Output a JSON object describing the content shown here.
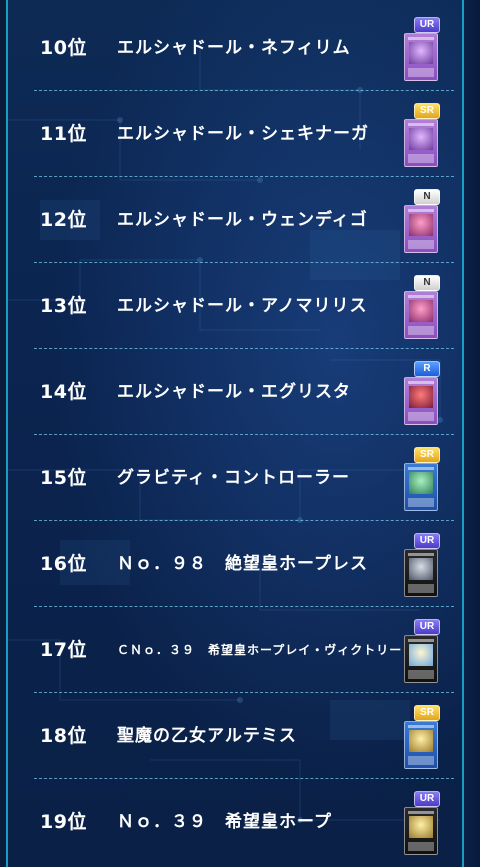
{
  "ranking": [
    {
      "rank": "10位",
      "name": "エルシャドール・ネフィリム",
      "rarity": "UR",
      "card_icon": "fusion-card-icon"
    },
    {
      "rank": "11位",
      "name": "エルシャドール・シェキナーガ",
      "rarity": "SR",
      "card_icon": "fusion-card-icon"
    },
    {
      "rank": "12位",
      "name": "エルシャドール・ウェンディゴ",
      "rarity": "N",
      "card_icon": "fusion-card-icon"
    },
    {
      "rank": "13位",
      "name": "エルシャドール・アノマリリス",
      "rarity": "N",
      "card_icon": "fusion-card-icon"
    },
    {
      "rank": "14位",
      "name": "エルシャドール・エグリスタ",
      "rarity": "R",
      "card_icon": "fusion-card-icon"
    },
    {
      "rank": "15位",
      "name": "グラビティ・コントローラー",
      "rarity": "SR",
      "card_icon": "link-card-icon"
    },
    {
      "rank": "16位",
      "name": "Ｎｏ．９８　絶望皇ホープレス",
      "rarity": "UR",
      "card_icon": "xyz-card-icon"
    },
    {
      "rank": "17位",
      "name": "ＣＮｏ．３９　希望皇ホープレイ・ヴィクトリー",
      "rarity": "UR",
      "card_icon": "xyz-card-icon"
    },
    {
      "rank": "18位",
      "name": "聖魔の乙女アルテミス",
      "rarity": "SR",
      "card_icon": "link-card-icon"
    },
    {
      "rank": "19位",
      "name": "Ｎｏ．３９　希望皇ホープ",
      "rarity": "UR",
      "card_icon": "xyz-card-icon"
    }
  ],
  "colors": {
    "background": "#0b2450",
    "accent_rail": "#1bb3d6",
    "badge_ur": "#5a4bd6",
    "badge_sr": "#f0c030",
    "badge_n": "#e6e6e6",
    "badge_r": "#2f6fe0"
  }
}
